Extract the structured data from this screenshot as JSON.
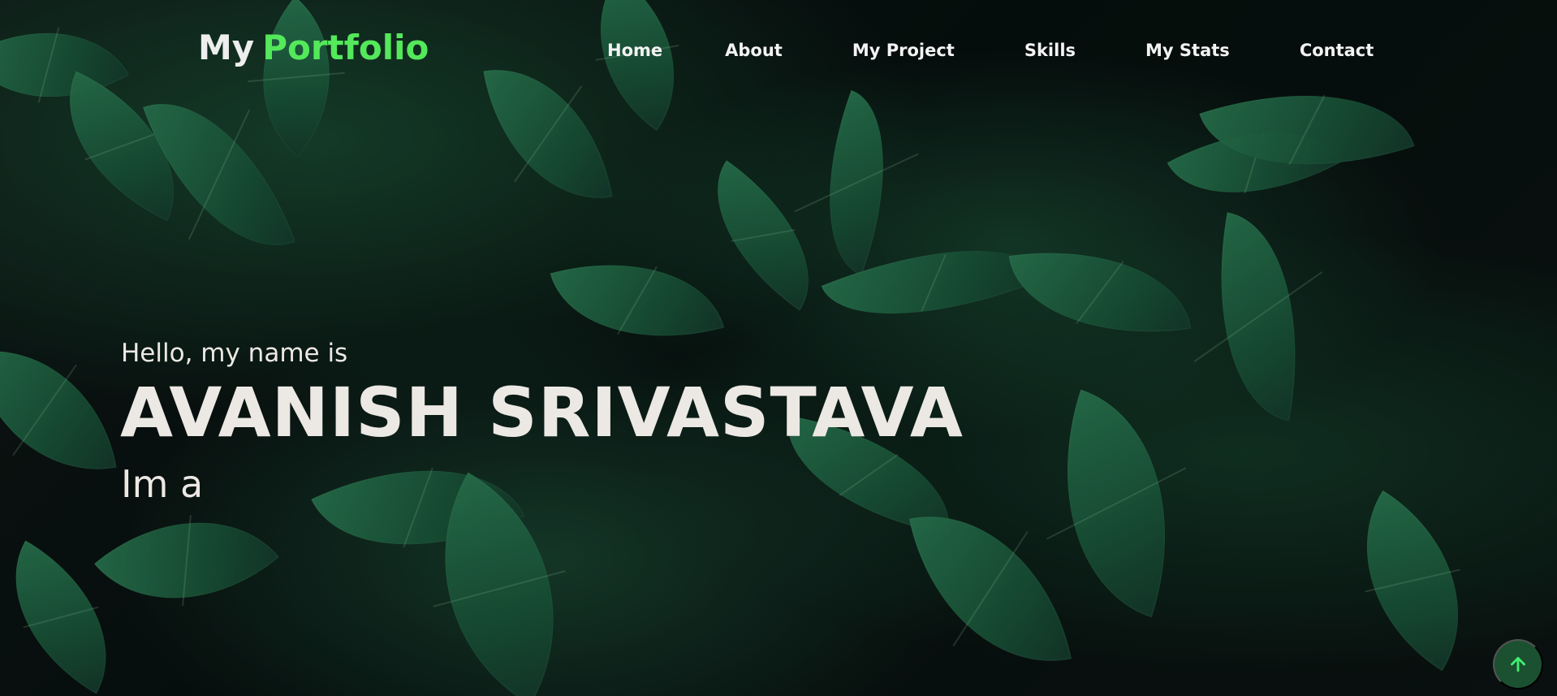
{
  "brand": {
    "prefix": "My",
    "accent": "Portfolio",
    "accent_color": "#54e85b"
  },
  "nav": {
    "items": [
      {
        "label": "Home"
      },
      {
        "label": "About"
      },
      {
        "label": "My Project"
      },
      {
        "label": "Skills"
      },
      {
        "label": "My Stats"
      },
      {
        "label": "Contact"
      }
    ]
  },
  "hero": {
    "greeting": "Hello, my name is",
    "name": "AVANISH SRIVASTAVA",
    "role_prefix": "Im a"
  },
  "icons": {
    "scroll_top": "arrow-up-icon"
  },
  "colors": {
    "text": "#ece8e4",
    "accent": "#54e85b",
    "button_bg": "#1b5130"
  }
}
